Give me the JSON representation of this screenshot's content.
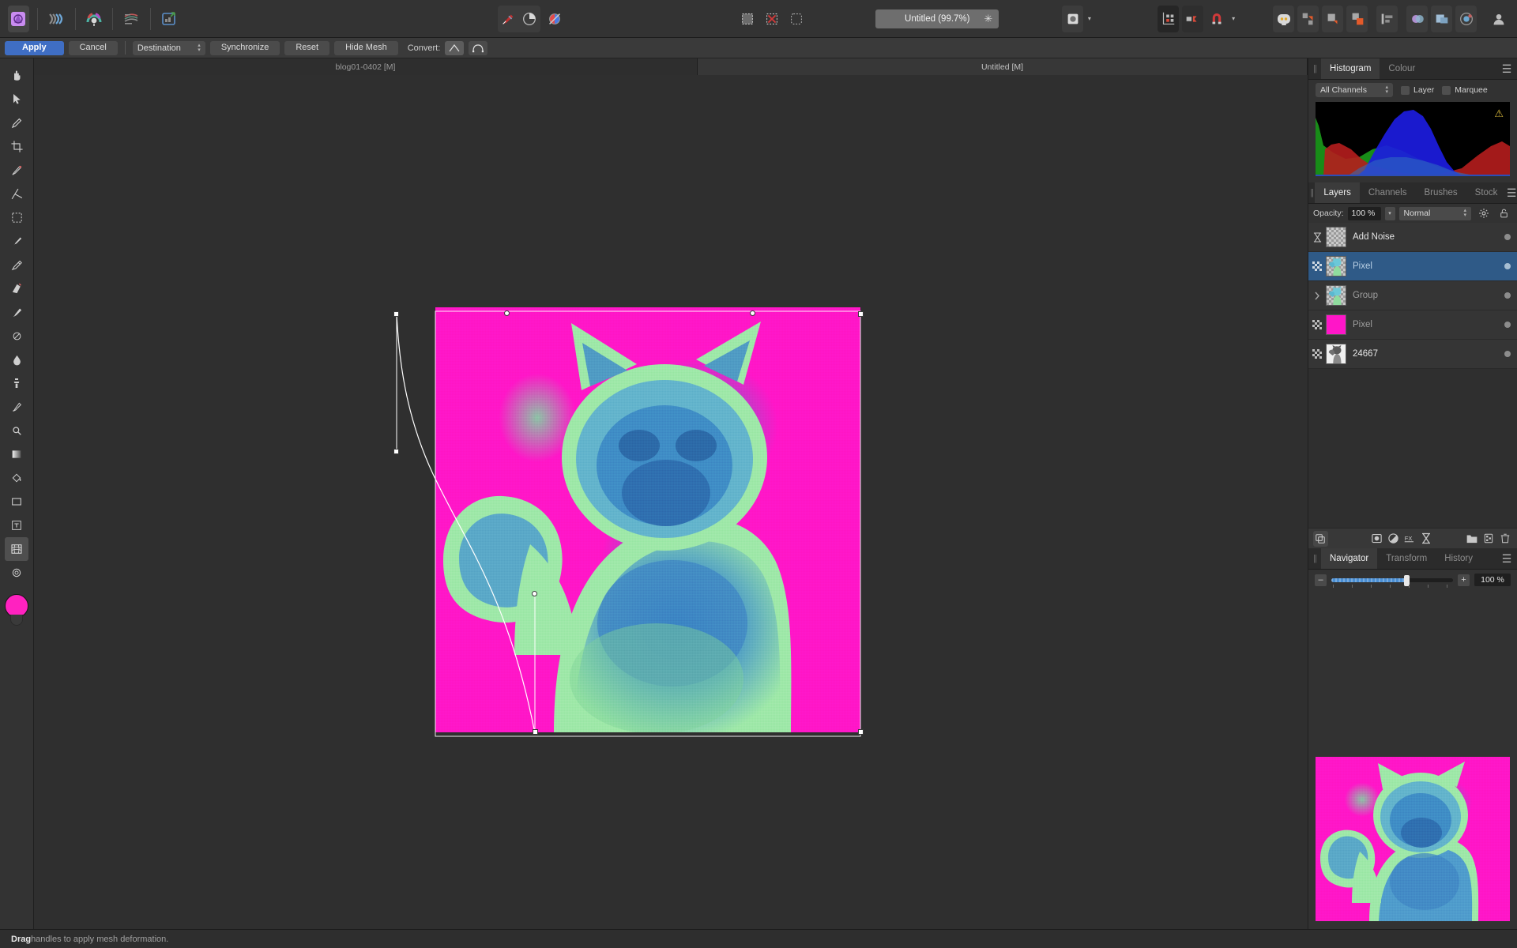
{
  "app": {
    "name": "Affinity Photo"
  },
  "toolbar": {
    "document_title": "Untitled (99.7%)",
    "modified_marker": "✳",
    "icons": [
      "affinity-photo-persona-icon",
      "liquify-persona-icon",
      "develop-persona-icon",
      "tone-mapping-persona-icon",
      "export-persona-icon",
      "colour-wheel-icon",
      "brush-picker-icon",
      "pixel-selection-icon",
      "deselect-icon",
      "refine-selection-icon",
      "preview-mode-icon",
      "snapping-grid-icon",
      "snapping-candidates-icon",
      "magnet-snapping-icon",
      "assistant-icon",
      "arrange-move-icon",
      "arrange-forward-icon",
      "arrange-back-icon",
      "align-icon",
      "colour-adjust-icon",
      "layer-effects-icon",
      "adjustment-icon",
      "account-icon"
    ]
  },
  "context_bar": {
    "apply_label": "Apply",
    "cancel_label": "Cancel",
    "destination_label": "Destination",
    "synchronize_label": "Synchronize",
    "reset_label": "Reset",
    "hide_mesh_label": "Hide Mesh",
    "convert_label": "Convert:",
    "convert_sharp_icon": "sharp-node-icon",
    "convert_smooth_icon": "smooth-node-icon"
  },
  "tools": {
    "items": [
      {
        "name": "view-tool",
        "selected": false
      },
      {
        "name": "move-tool",
        "selected": false
      },
      {
        "name": "colour-picker-tool",
        "selected": false
      },
      {
        "name": "crop-tool",
        "selected": false
      },
      {
        "name": "selection-brush-tool",
        "selected": false
      },
      {
        "name": "flood-select-tool",
        "selected": false
      },
      {
        "name": "marquee-tool",
        "selected": false
      },
      {
        "name": "paint-brush-tool",
        "selected": false
      },
      {
        "name": "pixel-tool",
        "selected": false
      },
      {
        "name": "erase-brush-tool",
        "selected": false
      },
      {
        "name": "dodge-brush-tool",
        "selected": false
      },
      {
        "name": "smudge-brush-tool",
        "selected": false
      },
      {
        "name": "blur-brush-tool",
        "selected": false
      },
      {
        "name": "clone-brush-tool",
        "selected": false
      },
      {
        "name": "patch-tool",
        "selected": false
      },
      {
        "name": "inpainting-brush-tool",
        "selected": false
      },
      {
        "name": "gradient-tool",
        "selected": false
      },
      {
        "name": "flood-fill-tool",
        "selected": false
      },
      {
        "name": "mesh-warp-tool",
        "selected": false
      },
      {
        "name": "rectangle-tool",
        "selected": false
      },
      {
        "name": "artistic-text-tool",
        "selected": false
      },
      {
        "name": "perspective-tool",
        "selected": true
      },
      {
        "name": "zoom-tool",
        "selected": false
      }
    ],
    "primary_colour": "#ff22c0"
  },
  "document_tabs": [
    {
      "label": "blog01-0402 [M]",
      "active": false
    },
    {
      "label": "Untitled [M]",
      "active": true
    }
  ],
  "canvas": {
    "artwork_name": "cat-photo-duotone",
    "magenta": "#ff16c8",
    "blue": "#3b86c4",
    "green": "#8fe6a4"
  },
  "status_bar": {
    "bold_word": "Drag",
    "message": " handles to apply mesh deformation."
  },
  "histogram_panel": {
    "tabs": [
      {
        "label": "Histogram",
        "active": true
      },
      {
        "label": "Colour",
        "active": false
      }
    ],
    "channel_select": "All Channels",
    "layer_checkbox": "Layer",
    "marquee_checkbox": "Marquee",
    "clipping_warning_icon": "clipping-warning-icon",
    "menu_icon": "panel-menu-icon"
  },
  "layers_panel": {
    "tabs": [
      {
        "label": "Layers",
        "active": true
      },
      {
        "label": "Channels",
        "active": false
      },
      {
        "label": "Brushes",
        "active": false
      },
      {
        "label": "Stock",
        "active": false
      }
    ],
    "opacity_label": "Opacity:",
    "opacity_value": "100 %",
    "blend_mode": "Normal",
    "gear_icon": "gear-icon",
    "lock_icon": "lock-icon",
    "layers": [
      {
        "name": "Add Noise",
        "type": "live-filter",
        "selected": false,
        "dim": false,
        "thumb": "checker"
      },
      {
        "name": "Pixel",
        "type": "pixel",
        "selected": true,
        "dim": true,
        "thumb": "cat"
      },
      {
        "name": "Group",
        "type": "group",
        "selected": false,
        "dim": true,
        "thumb": "cat"
      },
      {
        "name": "Pixel",
        "type": "pixel",
        "selected": false,
        "dim": true,
        "thumb": "magenta"
      },
      {
        "name": "24667",
        "type": "pixel",
        "selected": false,
        "dim": false,
        "thumb": "photo"
      }
    ],
    "actions": [
      "layer-stack-icon",
      "mask-layer-icon",
      "adjustment-layer-icon",
      "live-filter-icon",
      "live-filter-layer-icon",
      "new-group-icon",
      "new-pixel-layer-icon",
      "delete-layer-icon"
    ]
  },
  "navigator_panel": {
    "tabs": [
      {
        "label": "Navigator",
        "active": true
      },
      {
        "label": "Transform",
        "active": false
      },
      {
        "label": "History",
        "active": false
      }
    ],
    "zoom_out_label": "–",
    "zoom_in_label": "+",
    "zoom_value": "100 %",
    "menu_icon": "panel-menu-icon"
  }
}
